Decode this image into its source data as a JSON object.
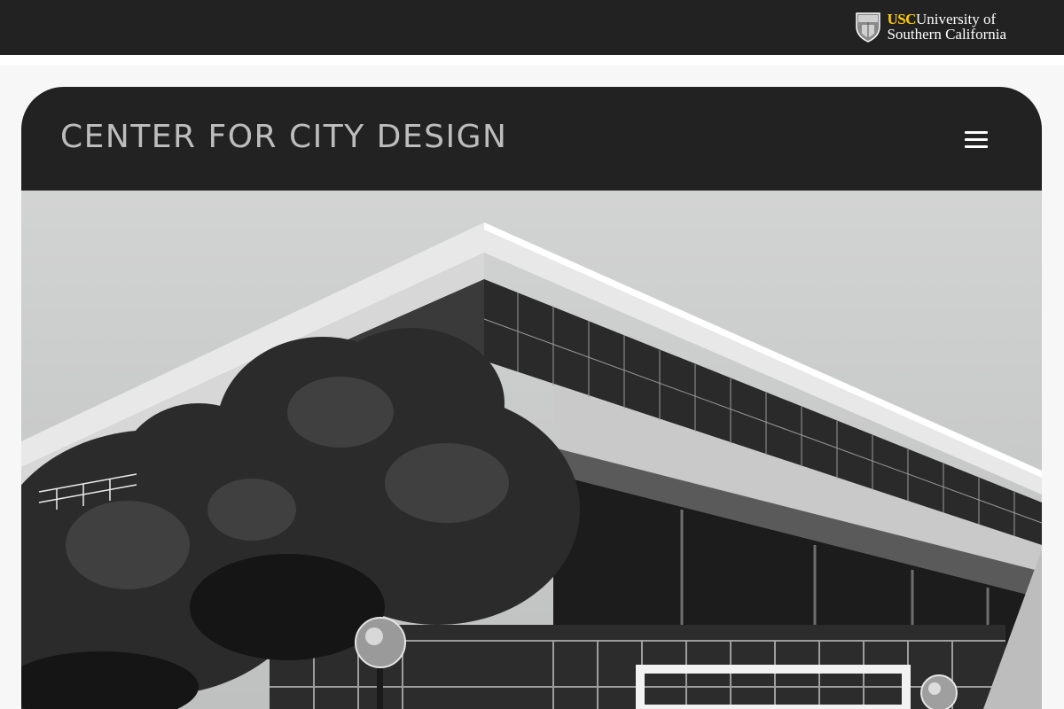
{
  "topbar": {
    "logo": {
      "abbr": "USC",
      "line1": "University of",
      "line2": "Southern California",
      "icon": "usc-shield-icon"
    }
  },
  "header": {
    "title": "CENTER FOR CITY DESIGN",
    "menu_icon": "hamburger-menu-icon"
  },
  "hero": {
    "image": "black-and-white photo of modernist building with trees and lamp posts"
  },
  "colors": {
    "bar_background": "#222222",
    "usc_gold": "#ffcc00",
    "title_gray": "#bdbdbd",
    "page_background": "#f7f7f7"
  }
}
